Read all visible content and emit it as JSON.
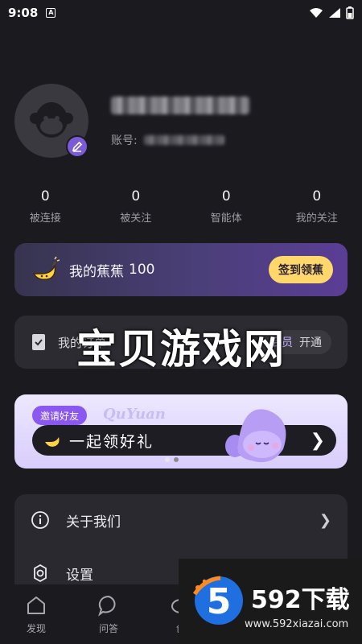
{
  "status_bar": {
    "time": "9:08",
    "app_badge": "A"
  },
  "profile": {
    "account_label": "账号:"
  },
  "stats": [
    {
      "value": "0",
      "label": "被连接"
    },
    {
      "value": "0",
      "label": "被关注"
    },
    {
      "value": "0",
      "label": "智能体"
    },
    {
      "value": "0",
      "label": "我的关注"
    }
  ],
  "banana": {
    "title": "我的蕉蕉",
    "amount": "100",
    "button": "签到领蕉"
  },
  "order": {
    "label": "我的订单",
    "vip_label": "会员",
    "vip_action": "开通"
  },
  "watermark": "宝贝游戏网",
  "invite": {
    "tag": "邀请好友",
    "brand": "QuYuan",
    "text": "一起领好礼"
  },
  "menu": [
    {
      "label": "关于我们",
      "icon": "info-icon"
    },
    {
      "label": "设置",
      "icon": "settings-icon"
    }
  ],
  "tabs": [
    {
      "label": "发现",
      "icon": "home-icon"
    },
    {
      "label": "问答",
      "icon": "chat-icon"
    },
    {
      "label": "创",
      "icon": "create-icon"
    }
  ],
  "ad": {
    "brand": "592下载",
    "url": "www.592xiazai.com",
    "logo_digit": "5"
  },
  "colors": {
    "background": "#1b1a1f",
    "accent": "#7b5cd6",
    "button_yellow": "#ffd76a"
  }
}
